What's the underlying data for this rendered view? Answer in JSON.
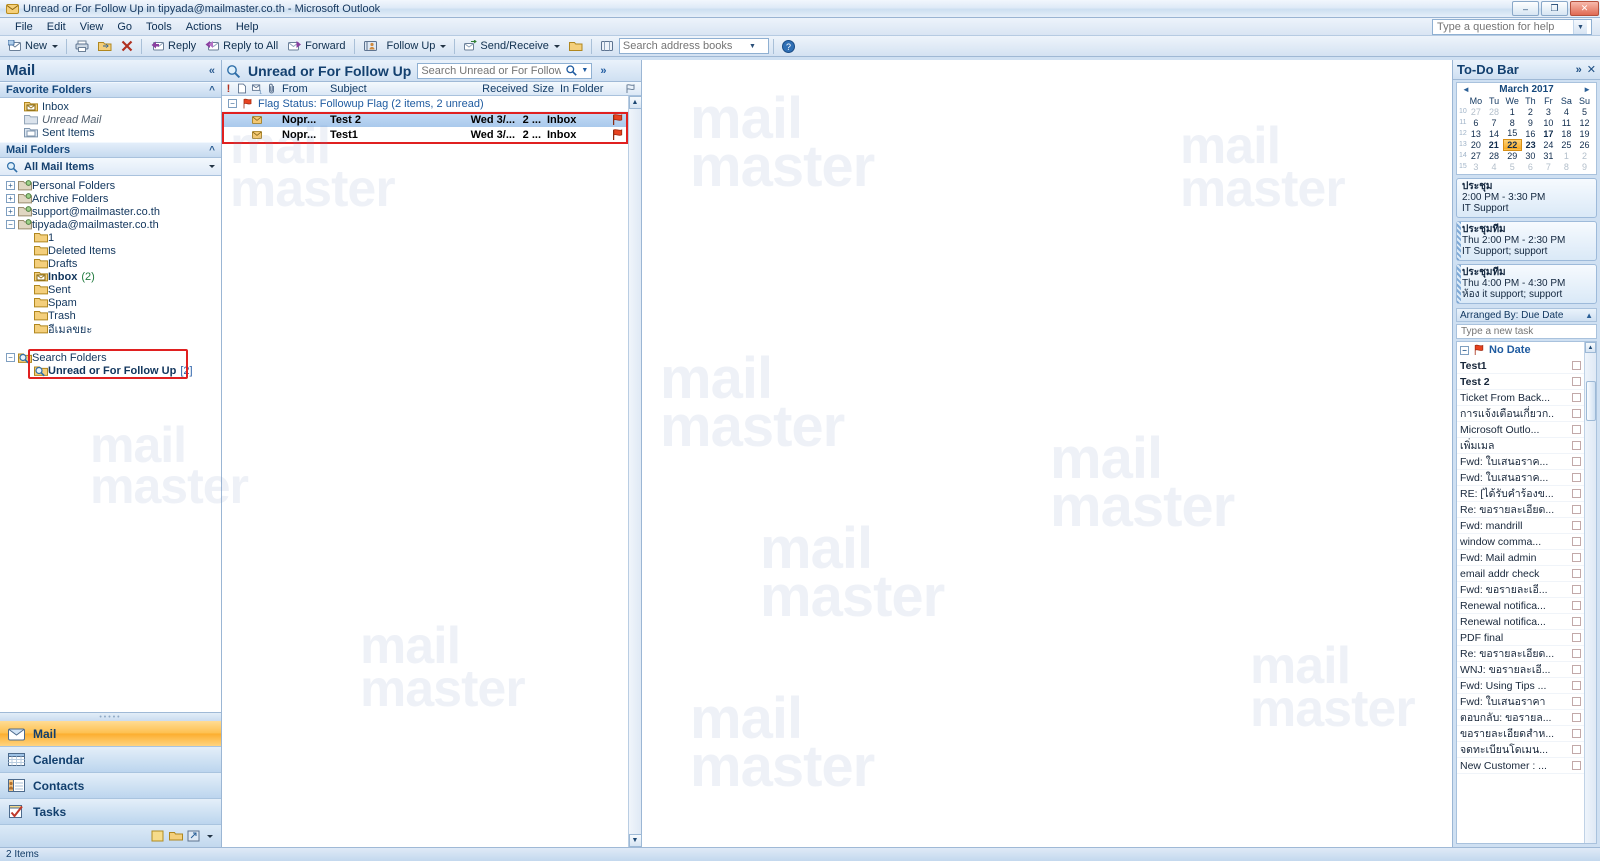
{
  "window": {
    "title": "Unread or For Follow Up in tipyada@mailmaster.co.th - Microsoft Outlook",
    "minimize": "–",
    "maximize": "❐",
    "close": "✕"
  },
  "menu": {
    "items": [
      "File",
      "Edit",
      "View",
      "Go",
      "Tools",
      "Actions",
      "Help"
    ]
  },
  "help_search": {
    "placeholder": "Type a question for help"
  },
  "toolbar": {
    "new_label": "New",
    "reply_label": "Reply",
    "reply_all_label": "Reply to All",
    "forward_label": "Forward",
    "follow_up_label": "Follow Up",
    "send_receive_label": "Send/Receive",
    "address_search_placeholder": "Search address books"
  },
  "navpane": {
    "header": "Mail",
    "favorite_folders_label": "Favorite Folders",
    "favorites": [
      {
        "label": "Inbox",
        "icon": "inbox-folder-icon",
        "italic": false
      },
      {
        "label": "Unread Mail",
        "icon": "unread-mail-icon",
        "italic": true
      },
      {
        "label": "Sent Items",
        "icon": "sent-folder-icon",
        "italic": false
      }
    ],
    "mail_folders_label": "Mail Folders",
    "all_mail_items": "All Mail Items",
    "tree": [
      {
        "label": "Personal Folders",
        "indent": 0,
        "expander": "+",
        "icon": "store-folder-icon",
        "count": ""
      },
      {
        "label": "Archive Folders",
        "indent": 0,
        "expander": "+",
        "icon": "store-folder-icon",
        "count": ""
      },
      {
        "label": "support@mailmaster.co.th",
        "indent": 0,
        "expander": "+",
        "icon": "store-folder-icon",
        "count": ""
      },
      {
        "label": "tipyada@mailmaster.co.th",
        "indent": 0,
        "expander": "-",
        "icon": "store-folder-icon",
        "count": ""
      },
      {
        "label": "1",
        "indent": 1,
        "expander": "",
        "icon": "folder-icon",
        "count": ""
      },
      {
        "label": "Deleted Items",
        "indent": 1,
        "expander": "",
        "icon": "folder-icon",
        "count": ""
      },
      {
        "label": "Drafts",
        "indent": 1,
        "expander": "",
        "icon": "folder-icon",
        "count": ""
      },
      {
        "label": "Inbox",
        "indent": 1,
        "expander": "",
        "icon": "inbox-folder-icon",
        "count": "(2)",
        "bold": true
      },
      {
        "label": "Sent",
        "indent": 1,
        "expander": "",
        "icon": "folder-icon",
        "count": ""
      },
      {
        "label": "Spam",
        "indent": 1,
        "expander": "",
        "icon": "folder-icon",
        "count": ""
      },
      {
        "label": "Trash",
        "indent": 1,
        "expander": "",
        "icon": "folder-icon",
        "count": ""
      },
      {
        "label": "อีเมลขยะ",
        "indent": 1,
        "expander": "",
        "icon": "folder-icon",
        "count": ""
      },
      {
        "label": "Search Folders",
        "indent": 0,
        "expander": "-",
        "icon": "search-folder-icon",
        "count": ""
      },
      {
        "label": "Unread or For Follow Up",
        "indent": 1,
        "expander": "",
        "icon": "search-folder-icon",
        "count": "[2]",
        "bold": true
      }
    ],
    "modules": [
      {
        "label": "Mail",
        "icon": "mail-module-icon",
        "active": true
      },
      {
        "label": "Calendar",
        "icon": "calendar-module-icon",
        "active": false
      },
      {
        "label": "Contacts",
        "icon": "contacts-module-icon",
        "active": false
      },
      {
        "label": "Tasks",
        "icon": "tasks-module-icon",
        "active": false
      }
    ]
  },
  "list": {
    "folder_title": "Unread or For Follow Up",
    "search_placeholder": "Search Unread or For Follow Up",
    "columns": [
      "!",
      "⚑",
      "✉",
      "ॐ",
      "From",
      "Subject",
      "Received",
      "Size",
      "In Folder"
    ],
    "group_header": "Flag Status: Followup Flag (2 items, 2 unread)",
    "messages": [
      {
        "from": "Nopr...",
        "subject": "Test 2",
        "received": "Wed 3/...",
        "size": "2 ...",
        "folder": "Inbox",
        "selected": true,
        "unread": true
      },
      {
        "from": "Nopr...",
        "subject": "Test1",
        "received": "Wed 3/...",
        "size": "2 ...",
        "folder": "Inbox",
        "selected": false,
        "unread": true
      }
    ]
  },
  "todobar": {
    "title": "To-Do Bar",
    "expand_icon": "»",
    "close_icon": "✕",
    "calendar": {
      "month_label": "March 2017",
      "prev": "◄",
      "next": "►",
      "weekdays": [
        "Mo",
        "Tu",
        "We",
        "Th",
        "Fr",
        "Sa",
        "Su"
      ],
      "weeks": [
        {
          "num": "10",
          "days": [
            {
              "d": "27",
              "o": true
            },
            {
              "d": "28",
              "o": true
            },
            {
              "d": "1"
            },
            {
              "d": "2"
            },
            {
              "d": "3"
            },
            {
              "d": "4"
            },
            {
              "d": "5"
            }
          ]
        },
        {
          "num": "11",
          "days": [
            {
              "d": "6"
            },
            {
              "d": "7"
            },
            {
              "d": "8"
            },
            {
              "d": "9"
            },
            {
              "d": "10"
            },
            {
              "d": "11"
            },
            {
              "d": "12"
            }
          ]
        },
        {
          "num": "12",
          "days": [
            {
              "d": "13"
            },
            {
              "d": "14"
            },
            {
              "d": "15"
            },
            {
              "d": "16"
            },
            {
              "d": "17",
              "b": true
            },
            {
              "d": "18"
            },
            {
              "d": "19"
            }
          ]
        },
        {
          "num": "13",
          "days": [
            {
              "d": "20"
            },
            {
              "d": "21",
              "b": true
            },
            {
              "d": "22",
              "today": true
            },
            {
              "d": "23",
              "b": true
            },
            {
              "d": "24"
            },
            {
              "d": "25"
            },
            {
              "d": "26"
            }
          ]
        },
        {
          "num": "14",
          "days": [
            {
              "d": "27"
            },
            {
              "d": "28"
            },
            {
              "d": "29"
            },
            {
              "d": "30"
            },
            {
              "d": "31"
            },
            {
              "d": "1",
              "o": true
            },
            {
              "d": "2",
              "o": true
            }
          ]
        },
        {
          "num": "15",
          "days": [
            {
              "d": "3",
              "o": true
            },
            {
              "d": "4",
              "o": true
            },
            {
              "d": "5",
              "o": true
            },
            {
              "d": "6",
              "o": true
            },
            {
              "d": "7",
              "o": true
            },
            {
              "d": "8",
              "o": true
            },
            {
              "d": "9",
              "o": true
            }
          ]
        }
      ]
    },
    "appointments": [
      {
        "title": "ประชุม",
        "time": "2:00 PM - 3:30 PM",
        "location": "IT Support",
        "busy": false
      },
      {
        "title": "ประชุมทีม",
        "time": "Thu 2:00 PM - 2:30 PM",
        "location": "IT Support; support",
        "busy": true
      },
      {
        "title": "ประชุมทีม",
        "time": "Thu 4:00 PM - 4:30 PM",
        "location": "ห้อง it support; support",
        "busy": true
      }
    ],
    "arranged_by": "Arranged By: Due Date",
    "new_task_placeholder": "Type a new task",
    "task_group": "No Date",
    "tasks": [
      {
        "label": "Test1",
        "bold": true
      },
      {
        "label": "Test 2",
        "bold": true
      },
      {
        "label": "Ticket From Back...",
        "bold": false
      },
      {
        "label": "การแจ้งเตือนเกี่ยวก..",
        "bold": false
      },
      {
        "label": "Microsoft Outlo...",
        "bold": false
      },
      {
        "label": "เพิ่มเมล",
        "bold": false
      },
      {
        "label": "Fwd: ใบเสนอราค...",
        "bold": false
      },
      {
        "label": "Fwd: ใบเสนอราค...",
        "bold": false
      },
      {
        "label": "RE: [ได้รับคำร้องข...",
        "bold": false
      },
      {
        "label": "Re: ขอรายละเอียด...",
        "bold": false
      },
      {
        "label": "Fwd: mandrill",
        "bold": false
      },
      {
        "label": "window comma...",
        "bold": false
      },
      {
        "label": "Fwd: Mail admin",
        "bold": false
      },
      {
        "label": "email addr check",
        "bold": false
      },
      {
        "label": "Fwd: ขอรายละเอี...",
        "bold": false
      },
      {
        "label": "Renewal notifica...",
        "bold": false
      },
      {
        "label": "Renewal notifica...",
        "bold": false
      },
      {
        "label": "PDF final",
        "bold": false
      },
      {
        "label": "Re: ขอรายละเอียด...",
        "bold": false
      },
      {
        "label": "WNJ: ขอรายละเอี...",
        "bold": false
      },
      {
        "label": "Fwd: Using Tips ...",
        "bold": false
      },
      {
        "label": "Fwd: ใบเสนอราคา",
        "bold": false
      },
      {
        "label": "ตอบกลับ: ขอรายล...",
        "bold": false
      },
      {
        "label": "ขอรายละเอียดสำห...",
        "bold": false
      },
      {
        "label": "จดทะเบียนโดเมน...",
        "bold": false
      },
      {
        "label": "New Customer : ...",
        "bold": false
      }
    ]
  },
  "statusbar": {
    "text": "2 Items"
  },
  "watermark": {
    "line1": "mail",
    "line2": "master"
  },
  "colors": {
    "highlight_red": "#e02020",
    "selection_blue": "#a9c9ec",
    "accent_orange": "#fcae2e",
    "flag_red": "#e8421f"
  }
}
